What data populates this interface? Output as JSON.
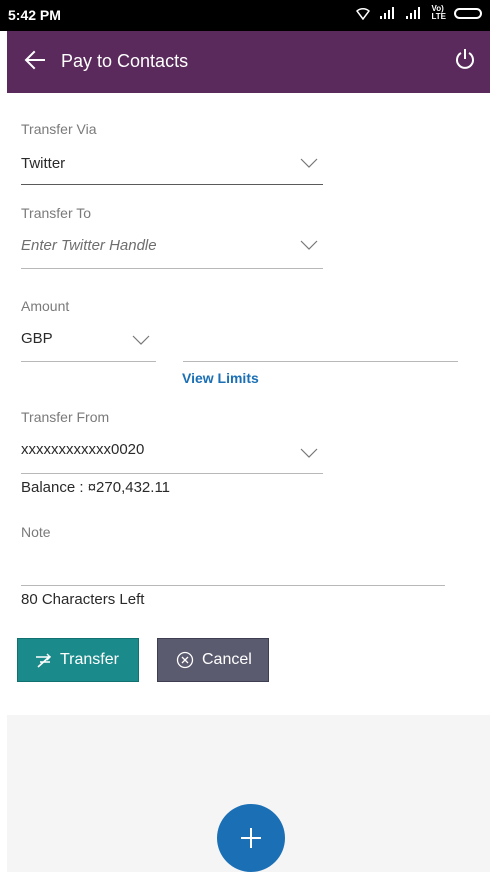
{
  "status_bar": {
    "time": "5:42 PM",
    "network_label": "Vo)\nLTE"
  },
  "app_bar": {
    "title": "Pay to Contacts"
  },
  "form": {
    "transfer_via": {
      "label": "Transfer Via",
      "value": "Twitter"
    },
    "transfer_to": {
      "label": "Transfer To",
      "placeholder": "Enter Twitter Handle"
    },
    "amount": {
      "label": "Amount",
      "currency": "GBP",
      "value": ""
    },
    "view_limits": "View Limits",
    "transfer_from": {
      "label": "Transfer From",
      "value": "xxxxxxxxxxxx0020",
      "balance": "Balance : ¤270,432.11"
    },
    "note": {
      "label": "Note",
      "value": "",
      "chars_left": "80 Characters Left"
    }
  },
  "buttons": {
    "transfer": "Transfer",
    "cancel": "Cancel"
  },
  "colors": {
    "app_bar": "#5a2a5c",
    "transfer_button": "#1a8a8a",
    "cancel_button": "#5b5b70",
    "link": "#1a6fb5",
    "fab": "#1a6fb5"
  }
}
